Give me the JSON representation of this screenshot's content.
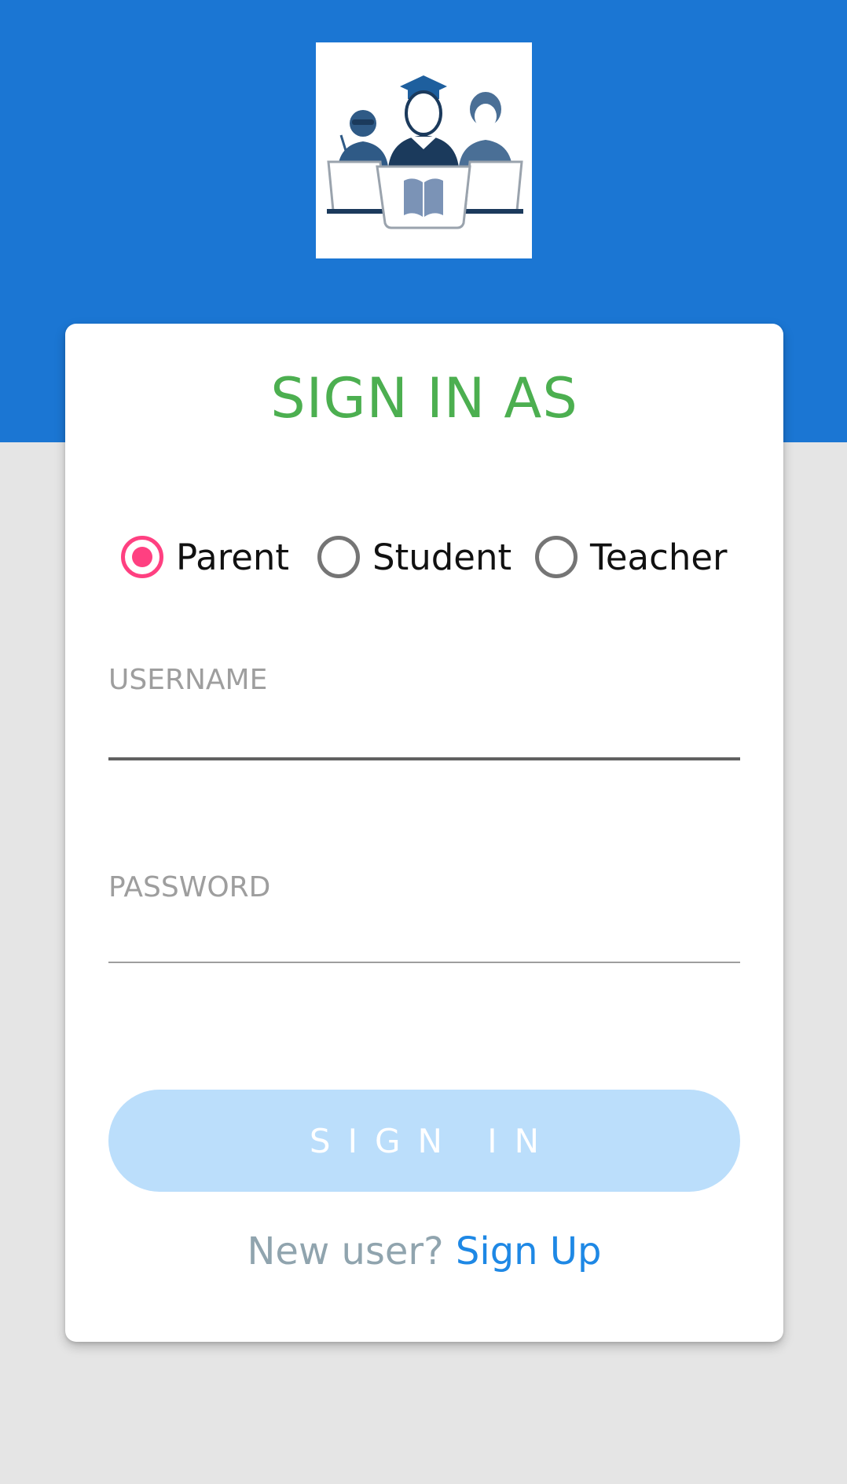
{
  "header": {
    "logo_icon": "students-teacher-book-icon",
    "background_color": "#1b76d3"
  },
  "card": {
    "title": "SIGN IN AS",
    "title_color": "#4caf50"
  },
  "roles": {
    "selected": "Parent",
    "options": [
      {
        "label": "Parent",
        "checked": true
      },
      {
        "label": "Student",
        "checked": false
      },
      {
        "label": "Teacher",
        "checked": false
      }
    ],
    "accent_color": "#ff4081"
  },
  "username": {
    "label": "USERNAME",
    "value": ""
  },
  "password": {
    "label": "PASSWORD",
    "value": ""
  },
  "sign_in_button": {
    "label": "SIGN IN",
    "background_color": "#bbdefb"
  },
  "signup": {
    "prompt": "New user?",
    "link_label": "Sign Up",
    "link_color": "#1e88e5"
  }
}
